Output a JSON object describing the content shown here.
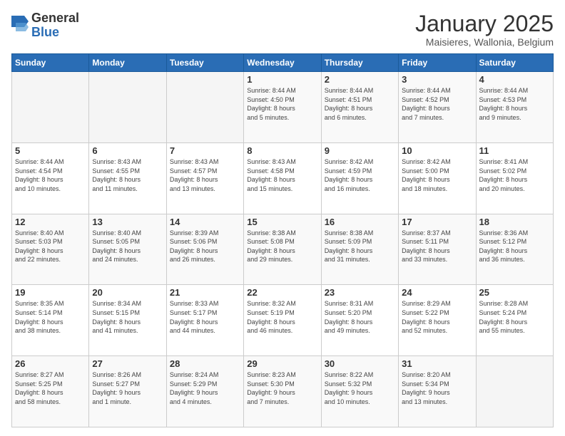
{
  "logo": {
    "general": "General",
    "blue": "Blue"
  },
  "header": {
    "month": "January 2025",
    "location": "Maisieres, Wallonia, Belgium"
  },
  "weekdays": [
    "Sunday",
    "Monday",
    "Tuesday",
    "Wednesday",
    "Thursday",
    "Friday",
    "Saturday"
  ],
  "weeks": [
    [
      {
        "day": "",
        "info": ""
      },
      {
        "day": "",
        "info": ""
      },
      {
        "day": "",
        "info": ""
      },
      {
        "day": "1",
        "info": "Sunrise: 8:44 AM\nSunset: 4:50 PM\nDaylight: 8 hours\nand 5 minutes."
      },
      {
        "day": "2",
        "info": "Sunrise: 8:44 AM\nSunset: 4:51 PM\nDaylight: 8 hours\nand 6 minutes."
      },
      {
        "day": "3",
        "info": "Sunrise: 8:44 AM\nSunset: 4:52 PM\nDaylight: 8 hours\nand 7 minutes."
      },
      {
        "day": "4",
        "info": "Sunrise: 8:44 AM\nSunset: 4:53 PM\nDaylight: 8 hours\nand 9 minutes."
      }
    ],
    [
      {
        "day": "5",
        "info": "Sunrise: 8:44 AM\nSunset: 4:54 PM\nDaylight: 8 hours\nand 10 minutes."
      },
      {
        "day": "6",
        "info": "Sunrise: 8:43 AM\nSunset: 4:55 PM\nDaylight: 8 hours\nand 11 minutes."
      },
      {
        "day": "7",
        "info": "Sunrise: 8:43 AM\nSunset: 4:57 PM\nDaylight: 8 hours\nand 13 minutes."
      },
      {
        "day": "8",
        "info": "Sunrise: 8:43 AM\nSunset: 4:58 PM\nDaylight: 8 hours\nand 15 minutes."
      },
      {
        "day": "9",
        "info": "Sunrise: 8:42 AM\nSunset: 4:59 PM\nDaylight: 8 hours\nand 16 minutes."
      },
      {
        "day": "10",
        "info": "Sunrise: 8:42 AM\nSunset: 5:00 PM\nDaylight: 8 hours\nand 18 minutes."
      },
      {
        "day": "11",
        "info": "Sunrise: 8:41 AM\nSunset: 5:02 PM\nDaylight: 8 hours\nand 20 minutes."
      }
    ],
    [
      {
        "day": "12",
        "info": "Sunrise: 8:40 AM\nSunset: 5:03 PM\nDaylight: 8 hours\nand 22 minutes."
      },
      {
        "day": "13",
        "info": "Sunrise: 8:40 AM\nSunset: 5:05 PM\nDaylight: 8 hours\nand 24 minutes."
      },
      {
        "day": "14",
        "info": "Sunrise: 8:39 AM\nSunset: 5:06 PM\nDaylight: 8 hours\nand 26 minutes."
      },
      {
        "day": "15",
        "info": "Sunrise: 8:38 AM\nSunset: 5:08 PM\nDaylight: 8 hours\nand 29 minutes."
      },
      {
        "day": "16",
        "info": "Sunrise: 8:38 AM\nSunset: 5:09 PM\nDaylight: 8 hours\nand 31 minutes."
      },
      {
        "day": "17",
        "info": "Sunrise: 8:37 AM\nSunset: 5:11 PM\nDaylight: 8 hours\nand 33 minutes."
      },
      {
        "day": "18",
        "info": "Sunrise: 8:36 AM\nSunset: 5:12 PM\nDaylight: 8 hours\nand 36 minutes."
      }
    ],
    [
      {
        "day": "19",
        "info": "Sunrise: 8:35 AM\nSunset: 5:14 PM\nDaylight: 8 hours\nand 38 minutes."
      },
      {
        "day": "20",
        "info": "Sunrise: 8:34 AM\nSunset: 5:15 PM\nDaylight: 8 hours\nand 41 minutes."
      },
      {
        "day": "21",
        "info": "Sunrise: 8:33 AM\nSunset: 5:17 PM\nDaylight: 8 hours\nand 44 minutes."
      },
      {
        "day": "22",
        "info": "Sunrise: 8:32 AM\nSunset: 5:19 PM\nDaylight: 8 hours\nand 46 minutes."
      },
      {
        "day": "23",
        "info": "Sunrise: 8:31 AM\nSunset: 5:20 PM\nDaylight: 8 hours\nand 49 minutes."
      },
      {
        "day": "24",
        "info": "Sunrise: 8:29 AM\nSunset: 5:22 PM\nDaylight: 8 hours\nand 52 minutes."
      },
      {
        "day": "25",
        "info": "Sunrise: 8:28 AM\nSunset: 5:24 PM\nDaylight: 8 hours\nand 55 minutes."
      }
    ],
    [
      {
        "day": "26",
        "info": "Sunrise: 8:27 AM\nSunset: 5:25 PM\nDaylight: 8 hours\nand 58 minutes."
      },
      {
        "day": "27",
        "info": "Sunrise: 8:26 AM\nSunset: 5:27 PM\nDaylight: 9 hours\nand 1 minute."
      },
      {
        "day": "28",
        "info": "Sunrise: 8:24 AM\nSunset: 5:29 PM\nDaylight: 9 hours\nand 4 minutes."
      },
      {
        "day": "29",
        "info": "Sunrise: 8:23 AM\nSunset: 5:30 PM\nDaylight: 9 hours\nand 7 minutes."
      },
      {
        "day": "30",
        "info": "Sunrise: 8:22 AM\nSunset: 5:32 PM\nDaylight: 9 hours\nand 10 minutes."
      },
      {
        "day": "31",
        "info": "Sunrise: 8:20 AM\nSunset: 5:34 PM\nDaylight: 9 hours\nand 13 minutes."
      },
      {
        "day": "",
        "info": ""
      }
    ]
  ]
}
